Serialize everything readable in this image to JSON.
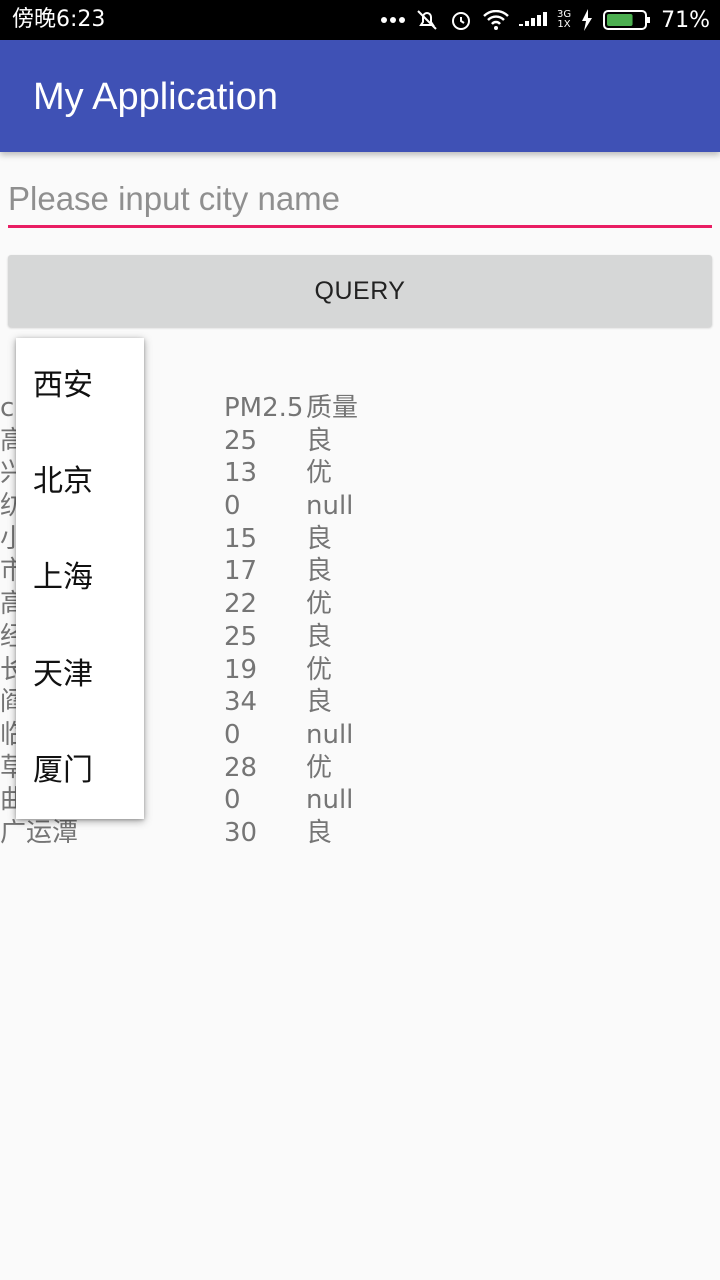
{
  "status_bar": {
    "time": "傍晚6:23",
    "battery_percent": "71%",
    "network_label_top": "3G",
    "network_label_bottom": "1X",
    "battery_level": 0.71
  },
  "app_bar": {
    "title": "My Application",
    "color": "#3f51b5"
  },
  "search": {
    "placeholder": "Please input city name",
    "value": "",
    "underline_color": "#e91e63"
  },
  "query_button": {
    "label": "QUERY"
  },
  "results": {
    "header": {
      "station": "c",
      "pm": "PM2.5",
      "quality": "质量"
    },
    "rows": [
      {
        "station": "高",
        "pm": "25",
        "quality": "良"
      },
      {
        "station": "兴",
        "pm": "13",
        "quality": "优"
      },
      {
        "station": "纺",
        "pm": "0",
        "quality": "null"
      },
      {
        "station": "小",
        "pm": "15",
        "quality": "良"
      },
      {
        "station": "市                场",
        "pm": "17",
        "quality": "良"
      },
      {
        "station": "高",
        "pm": "22",
        "quality": "优"
      },
      {
        "station": "经",
        "pm": "25",
        "quality": "良"
      },
      {
        "station": "长",
        "pm": "19",
        "quality": "优"
      },
      {
        "station": "阎",
        "pm": "34",
        "quality": "良"
      },
      {
        "station": "临",
        "pm": "0",
        "quality": "null"
      },
      {
        "station": "草",
        "pm": "28",
        "quality": "优"
      },
      {
        "station": "曲              业集团",
        "pm": "0",
        "quality": "null"
      },
      {
        "station": "广运潭",
        "pm": "30",
        "quality": "良"
      }
    ]
  },
  "dropdown": {
    "options": [
      "西安",
      "北京",
      "上海",
      "天津",
      "厦门"
    ]
  }
}
